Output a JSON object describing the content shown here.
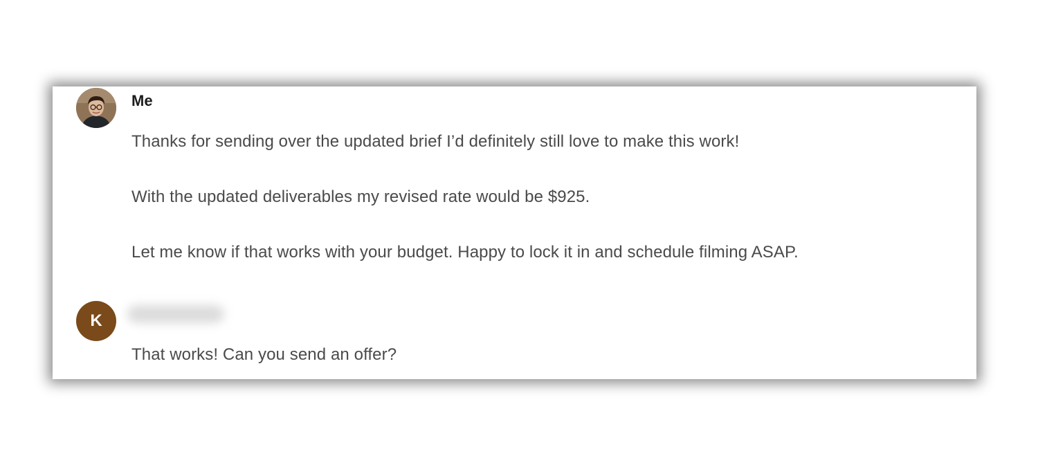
{
  "messages": [
    {
      "sender": "Me",
      "avatar": "user-photo",
      "lines": [
        "Thanks for sending over the updated brief I’d definitely still love to make this work!",
        "With the updated deliverables my revised rate would be $925.",
        "Let me know if that works with your budget. Happy to lock it in and schedule filming ASAP."
      ]
    },
    {
      "sender": "",
      "avatar_initial": "K",
      "avatar_color": "#7a4a1a",
      "lines": [
        "That works! Can you send an offer?"
      ]
    }
  ]
}
